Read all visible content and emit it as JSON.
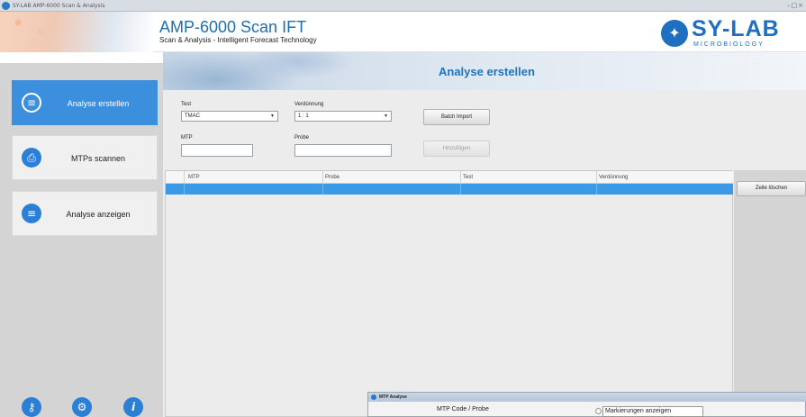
{
  "window": {
    "title": "SY-LAB AMP-6000 Scan & Analysis"
  },
  "header": {
    "title": "AMP-6000 Scan IFT",
    "subtitle": "Scan & Analysis - Intelligent Forecast Technology",
    "logo_text": "SY-LAB",
    "logo_sub": "MICROBIOLOGY"
  },
  "sidebar": {
    "items": [
      {
        "label": "Analyse erstellen",
        "icon": "create-analysis-icon",
        "active": true
      },
      {
        "label": "MTPs scannen",
        "icon": "scanner-icon",
        "active": false
      },
      {
        "label": "Analyse anzeigen",
        "icon": "list-icon",
        "active": false
      }
    ],
    "footer_icons": [
      "user-key-icon",
      "gear-icon",
      "info-icon"
    ]
  },
  "page": {
    "title": "Analyse erstellen"
  },
  "form": {
    "test": {
      "label": "Test",
      "value": "TMAC"
    },
    "dilution": {
      "label": "Verdünnung",
      "value": "1 : 1"
    },
    "mtp": {
      "label": "MTP",
      "value": ""
    },
    "sample": {
      "label": "Probe",
      "value": ""
    },
    "batch_import_label": "Batch Import",
    "add_label": "Hinzufügen"
  },
  "table": {
    "columns": [
      "MTP",
      "Probe",
      "Test",
      "Verdünnung"
    ],
    "rows": [
      [
        "",
        "",
        "",
        ""
      ]
    ],
    "selected_row": 0
  },
  "actions": {
    "delete_row_label": "Zeile löschen"
  },
  "subwindow": {
    "title": "MTP Analyse",
    "field_label": "MTP Code / Probe",
    "checkbox_label": "Markierungen anzeigen"
  },
  "colors": {
    "accent": "#3b8fdc",
    "brand": "#1e6fc0",
    "selection": "#3b9ae6"
  }
}
